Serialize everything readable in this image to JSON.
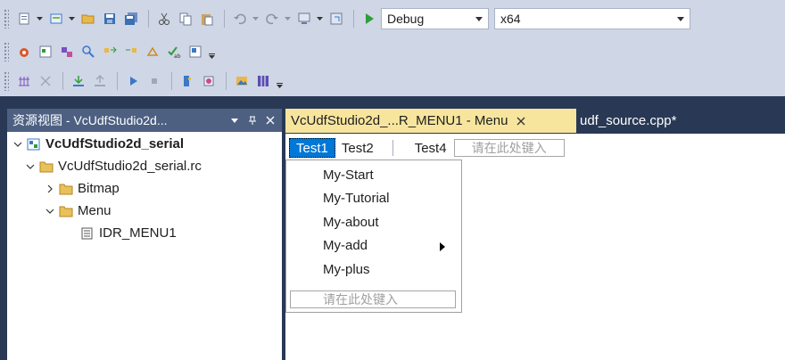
{
  "toolbar": {
    "configuration": "Debug",
    "platform": "x64",
    "row1_icons": [
      "new-project-icon",
      "add-item-icon",
      "open-file-icon",
      "save-icon",
      "save-all-icon",
      "cut-icon",
      "copy-icon",
      "paste-icon",
      "undo-icon",
      "redo-icon",
      "navigate-icon",
      "navigate-forward-icon",
      "start-debug-icon"
    ],
    "row2_icons": [
      "build-icon",
      "class-wizard-icon",
      "resource-icon",
      "find-icon",
      "align-left-icon",
      "align-right-icon",
      "tab-order-icon",
      "spell-check-icon",
      "format-icon"
    ],
    "row3_icons": [
      "grid-icon",
      "test-icon",
      "download-icon",
      "upload-icon",
      "play-icon",
      "stop-icon",
      "bookmark-icon",
      "breakpoint-icon",
      "image-editor-icon",
      "columns-icon"
    ]
  },
  "panel": {
    "title": "资源视图 - VcUdfStudio2d...",
    "pin_glyph": "ꟼ",
    "tree": [
      {
        "label": "VcUdfStudio2d_serial",
        "level": 0,
        "expanded": true,
        "icon": "project-icon"
      },
      {
        "label": "VcUdfStudio2d_serial.rc",
        "level": 1,
        "expanded": true,
        "icon": "folder-icon"
      },
      {
        "label": "Bitmap",
        "level": 2,
        "expanded": false,
        "icon": "folder-icon"
      },
      {
        "label": "Menu",
        "level": 2,
        "expanded": true,
        "icon": "folder-icon"
      },
      {
        "label": "IDR_MENU1",
        "level": 3,
        "icon": "menu-resource-icon"
      }
    ]
  },
  "tabs": {
    "active": "VcUdfStudio2d_...R_MENU1 - Menu",
    "second": "udf_source.cpp*"
  },
  "menu": {
    "bar": [
      "Test1",
      "Test2",
      "Test4"
    ],
    "placeholder": "请在此处键入",
    "items": [
      "My-Start",
      "My-Tutorial",
      "My-about",
      "My-add",
      "My-plus"
    ]
  },
  "colors": {
    "toolbar_bg": "#cfd6e5",
    "dock_bg": "#293955",
    "panel_header": "#4d6082",
    "active_tab": "#f7e59e",
    "menu_selected": "#0078d7"
  }
}
